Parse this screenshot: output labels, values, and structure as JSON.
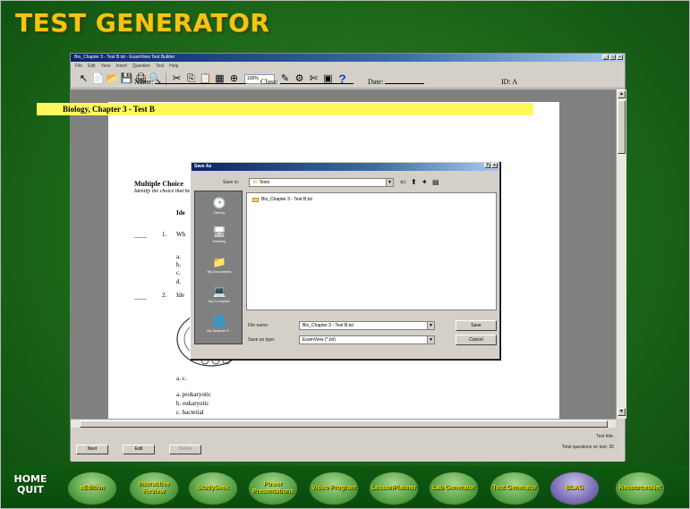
{
  "app_title": "TEST GENERATOR",
  "window": {
    "title": "Bio_Chapter 3 - Test B.tst - ExamView Test Builder",
    "menu": [
      "File",
      "Edit",
      "View",
      "Insert",
      "Question",
      "Test",
      "Help"
    ],
    "zoom": "100%",
    "toolbar_icons": [
      "select-icon",
      "new-icon",
      "open-icon",
      "save-icon",
      "print-icon",
      "find-icon",
      "cut-icon",
      "copy-icon",
      "paste-icon",
      "table-icon",
      "zoom-icon",
      "edit-icon",
      "settings-icon",
      "scissors-icon",
      "image-icon",
      "help-icon"
    ]
  },
  "page": {
    "name_label": "Name:",
    "class_label": "Class:",
    "date_label": "Date:",
    "id_label": "ID: A",
    "chapter_title": "Biology, Chapter 3 - Test B",
    "section_title": "Multiple Choice",
    "section_instructions": "Identify the choice that best completes the statement or answers the question.",
    "q1_number": "1.",
    "q1_stem": "Wh",
    "q1_choices": [
      "a.",
      "b.",
      "c.",
      "d."
    ],
    "q2_number": "2.",
    "q2_stem": "Ide",
    "q2_tail": "a. c.",
    "q2_choices": [
      "a.   prokaryotic",
      "b.   eukaryotic",
      "c.   bacterial"
    ]
  },
  "dialog": {
    "title": "Save As",
    "save_in_label": "Save in:",
    "save_in_value": "Tests",
    "places": [
      "History",
      "Desktop",
      "My Documents",
      "My Computer",
      "My Network P..."
    ],
    "files": [
      "Bio_Chapter 3 - Test B.tst"
    ],
    "file_name_label": "File name:",
    "file_name_value": "Bio_Chapter 3 - Test B.tst",
    "save_as_type_label": "Save as type:",
    "save_as_type_value": "ExamView (*.tst)",
    "save_button": "Save",
    "cancel_button": "Cancel"
  },
  "status": {
    "next_button": "Next",
    "edit_button": "Edit",
    "delete_button": "Delete",
    "test_title": "Test title:",
    "total_questions": "Total questions on test: 35"
  },
  "bottom_nav": {
    "home_line1": "HOME",
    "home_line2": "QUIT",
    "items": [
      "eEdition",
      "Interactive Review",
      "StudySeek",
      "Power Presentations",
      "Video Program",
      "LessonPlanner",
      "Lab Generator",
      "Test Generator",
      "BLAG",
      "ResourcesNet"
    ]
  }
}
